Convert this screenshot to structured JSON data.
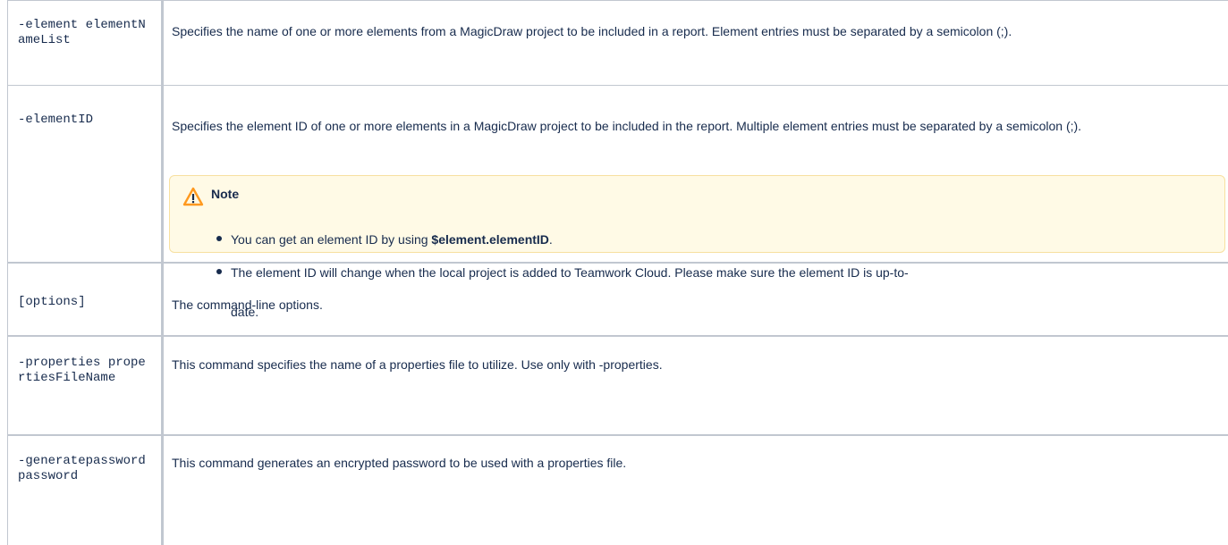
{
  "rows": [
    {
      "param": "-element elementNameList",
      "desc": "Specifies the name of one or more elements from a MagicDraw project to be included in a report. Element entries must be separated by a semicolon (;)."
    },
    {
      "param": "-elementID",
      "desc": "Specifies the element ID of one or more elements in a MagicDraw project to be included in the report. Multiple element entries must be separated by a semicolon (;).",
      "note": {
        "title": "Note",
        "icon": "warning-icon",
        "bullet1_prefix": "You can get an element ID by using ",
        "bullet1_code": "$element.elementID",
        "bullet1_suffix": ".",
        "bullet2": "The element ID will change when the local project is added to Teamwork Cloud. Please make sure the element ID is up-to-",
        "bullet2_tail": "date."
      }
    },
    {
      "param": "[options]",
      "desc": "The command-line options."
    },
    {
      "param": "-properties propertiesFileName",
      "desc": "This command specifies the name of a properties file to utilize. Use only with -properties."
    },
    {
      "param": "-generatepassword password",
      "desc": "This command generates an encrypted password to be used with a properties file."
    }
  ],
  "colors": {
    "text": "#172b4d",
    "border": "#c1c7d0",
    "note_bg": "#fffae6",
    "warning": "#ff991f"
  }
}
